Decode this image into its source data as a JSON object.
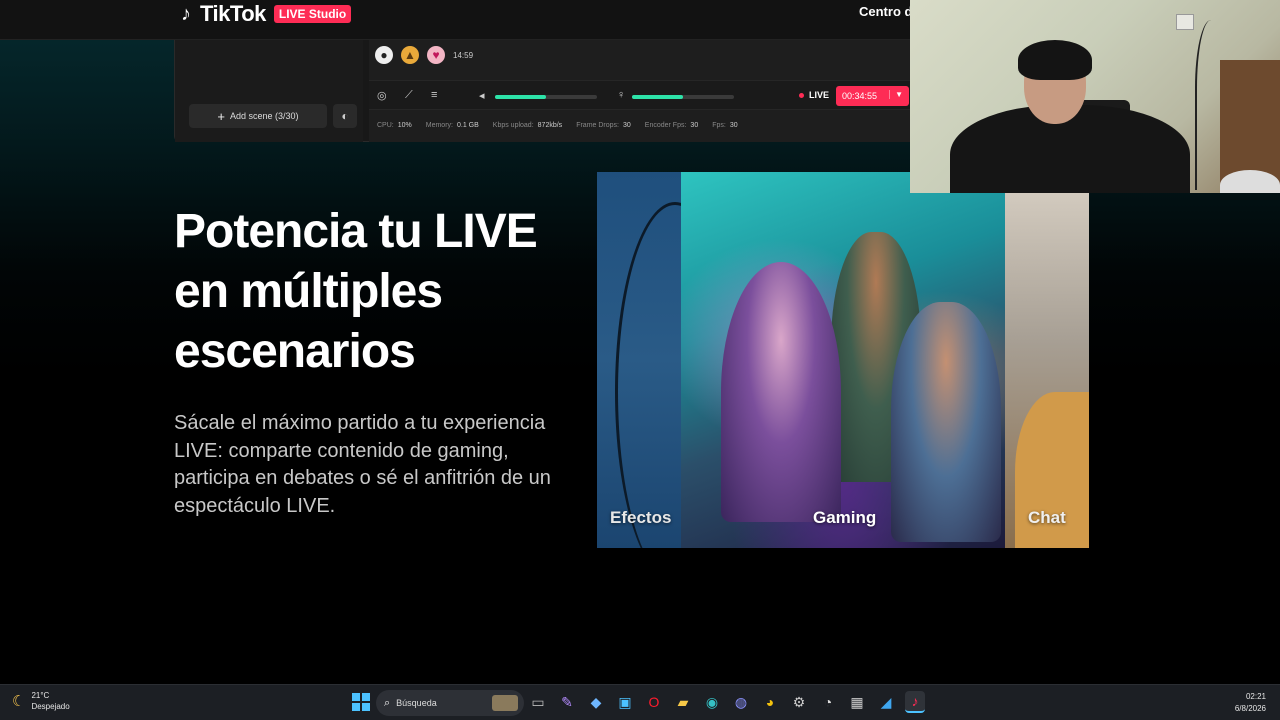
{
  "header": {
    "logo_text": "TikTok",
    "logo_badge": "LIVE Studio",
    "nav_link": "Centro de"
  },
  "studio": {
    "add_scene_label": "Add scene (3/30)",
    "gift_time": "14:59",
    "volume_level": 0.5,
    "mic_level": 0.5,
    "live_label": "LIVE",
    "timer": "00:34:55",
    "stats": [
      {
        "label": "CPU:",
        "value": "10%"
      },
      {
        "label": "Memory:",
        "value": "0.1 GB"
      },
      {
        "label": "Kbps upload:",
        "value": "872kb/s"
      },
      {
        "label": "Frame Drops:",
        "value": "30"
      },
      {
        "label": "Encoder Fps:",
        "value": "30"
      },
      {
        "label": "Fps:",
        "value": "30"
      }
    ]
  },
  "hero": {
    "title_lines": [
      "Potencia tu LIVE",
      "en múltiples",
      "escenarios"
    ],
    "description": "Sácale el máximo partido a tu experiencia LIVE: comparte contenido de gaming, participa en debates o sé el anfitrión de un espectáculo LIVE."
  },
  "carousel": {
    "panels": [
      {
        "label": "Efectos"
      },
      {
        "label": "Gaming"
      },
      {
        "label": "Chat"
      }
    ]
  },
  "taskbar": {
    "weather_temp": "21°C",
    "weather_desc": "Despejado",
    "search_placeholder": "Búsqueda",
    "time": "02:21",
    "date": "6/8/2026",
    "apps": [
      "file-explorer-icon",
      "pen-icon",
      "copilot-icon",
      "store-icon",
      "opera-icon",
      "folder-icon",
      "edge-icon",
      "discord-icon",
      "chrome-icon",
      "settings-icon",
      "obs-icon",
      "calculator-icon",
      "vscode-icon",
      "tiktok-live-icon"
    ]
  }
}
